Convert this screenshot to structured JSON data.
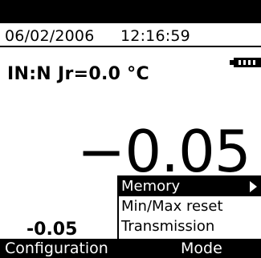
{
  "status_bar": {
    "date": "06/02/2006",
    "time": "12:16:59",
    "battery_icon": "battery-full-icon"
  },
  "measurement": {
    "channel_info": "IN:N Jr=0.0 °C",
    "main_value": "−0.05",
    "secondary_value": "-0.05"
  },
  "menu": {
    "items": [
      {
        "label": "Memory",
        "selected": true,
        "has_submenu": true
      },
      {
        "label": "Min/Max reset",
        "selected": false,
        "has_submenu": false
      },
      {
        "label": "Transmission",
        "selected": false,
        "has_submenu": false
      }
    ]
  },
  "softkeys": {
    "left_label": "Configuration",
    "right_label": "Mode"
  },
  "colors": {
    "foreground": "#000000",
    "background": "#ffffff"
  }
}
